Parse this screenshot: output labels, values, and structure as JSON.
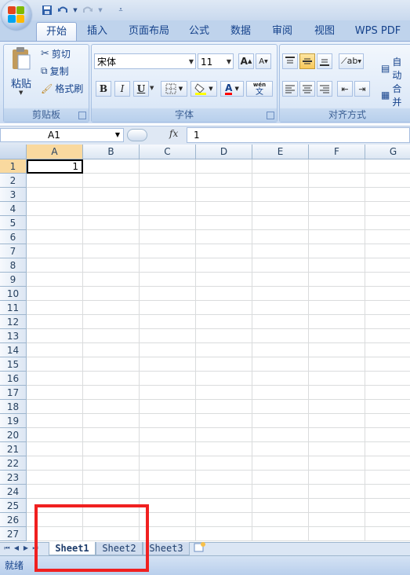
{
  "quick_access": {
    "save_icon": "save-icon",
    "undo_icon": "undo-icon",
    "redo_icon": "redo-icon",
    "customize_icon": "customize-quick-access-icon"
  },
  "tabs": [
    "开始",
    "插入",
    "页面布局",
    "公式",
    "数据",
    "审阅",
    "视图",
    "WPS PDF"
  ],
  "active_tab": "开始",
  "clipboard": {
    "paste": "粘贴",
    "cut": "剪切",
    "copy": "复制",
    "format_painter": "格式刷",
    "group_label": "剪贴板"
  },
  "font": {
    "name": "宋体",
    "size": "11",
    "bold": "B",
    "italic": "I",
    "underline": "U",
    "phonetic": "wén",
    "phonetic_char": "文",
    "group_label": "字体",
    "grow": "A",
    "shrink": "A",
    "font_color": "A"
  },
  "alignment": {
    "wrap_text": "自动",
    "merge": "合并",
    "group_label": "对齐方式"
  },
  "formula_bar": {
    "name_box": "A1",
    "fx": "fx",
    "value": "1"
  },
  "columns": [
    "A",
    "B",
    "C",
    "D",
    "E",
    "F",
    "G"
  ],
  "rows": [
    "1",
    "2",
    "3",
    "4",
    "5",
    "6",
    "7",
    "8",
    "9",
    "10",
    "11",
    "12",
    "13",
    "14",
    "15",
    "16",
    "17",
    "18",
    "19",
    "20",
    "21",
    "22",
    "23",
    "24",
    "25",
    "26",
    "27"
  ],
  "cells": {
    "A1": "1"
  },
  "sheets": [
    "Sheet1",
    "Sheet2",
    "Sheet3"
  ],
  "status": "就绪",
  "colors": {
    "accent": "#15428b",
    "active_header": "#f9d99f",
    "highlight_box": "#f02020"
  }
}
